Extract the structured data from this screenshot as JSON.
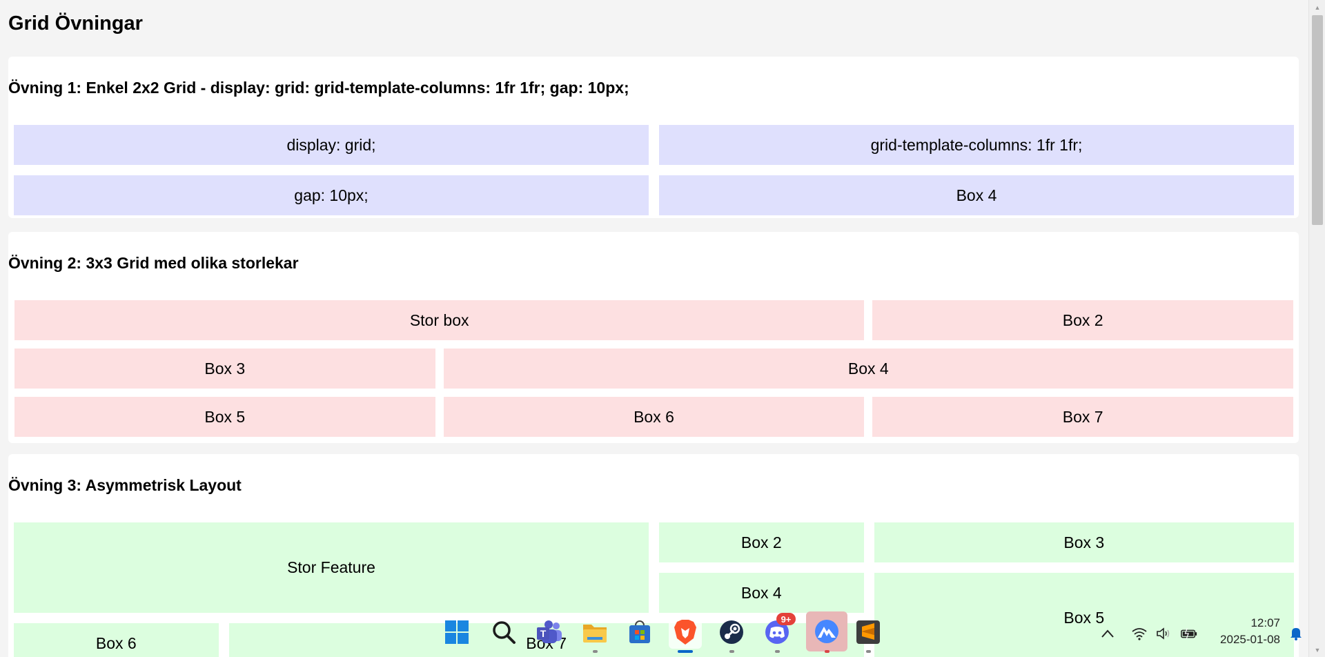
{
  "page": {
    "title": "Grid Övningar"
  },
  "sections": [
    {
      "heading": "Övning 1: Enkel 2x2 Grid - display: grid: grid-template-columns: 1fr 1fr; gap: 10px;",
      "boxes": [
        "display: grid;",
        "grid-template-columns: 1fr 1fr;",
        "gap: 10px;",
        "Box 4"
      ]
    },
    {
      "heading": "Övning 2: 3x3 Grid med olika storlekar",
      "boxes": [
        "Stor box",
        "Box 2",
        "Box 3",
        "Box 4",
        "Box 5",
        "Box 6",
        "Box 7"
      ]
    },
    {
      "heading": "Övning 3: Asymmetrisk Layout",
      "boxes": [
        "Stor Feature",
        "Box 2",
        "Box 3",
        "Box 4",
        "Box 5",
        "Box 6",
        "Box 7"
      ]
    }
  ],
  "colors": {
    "section1_box": "#dfe0fd",
    "section2_box": "#fde0e1",
    "section3_box": "#dcfedf"
  },
  "taskbar": {
    "apps": [
      {
        "name": "start-menu",
        "icon": "windows-logo-icon"
      },
      {
        "name": "search",
        "icon": "search-icon"
      },
      {
        "name": "teams",
        "icon": "teams-icon"
      },
      {
        "name": "file-explorer",
        "icon": "folder-icon"
      },
      {
        "name": "microsoft-store",
        "icon": "store-icon"
      },
      {
        "name": "brave",
        "icon": "brave-lion-icon"
      },
      {
        "name": "steam",
        "icon": "steam-icon"
      },
      {
        "name": "discord",
        "icon": "discord-icon",
        "badge": "9+"
      },
      {
        "name": "nordvpn",
        "icon": "nordvpn-icon"
      },
      {
        "name": "sublime-text",
        "icon": "sublime-text-icon"
      }
    ],
    "clock": {
      "time": "12:07",
      "date": "2025-01-08"
    }
  }
}
